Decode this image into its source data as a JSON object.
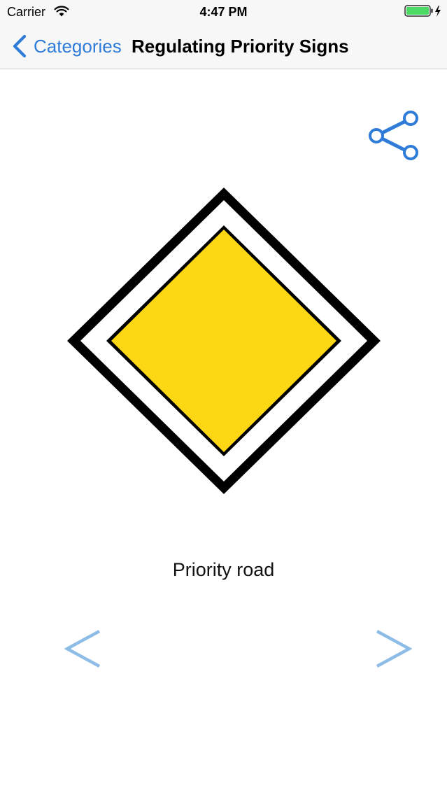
{
  "status_bar": {
    "carrier": "Carrier",
    "time": "4:47 PM",
    "wifi_icon": "wifi-icon",
    "battery_icon": "battery-charging-icon",
    "battery_color": "#4cd964"
  },
  "nav_bar": {
    "back_label": "Categories",
    "title": "Regulating Priority Signs",
    "accent_color": "#2f7bd8"
  },
  "content": {
    "share_icon": "share-icon",
    "sign_name": "Priority road",
    "sign_colors": {
      "outer_border": "#000000",
      "white_band": "#ffffff",
      "inner_fill": "#fdd713"
    },
    "prev_icon": "chevron-left-icon",
    "next_icon": "chevron-right-icon",
    "arrow_color": "#8dbde6"
  }
}
